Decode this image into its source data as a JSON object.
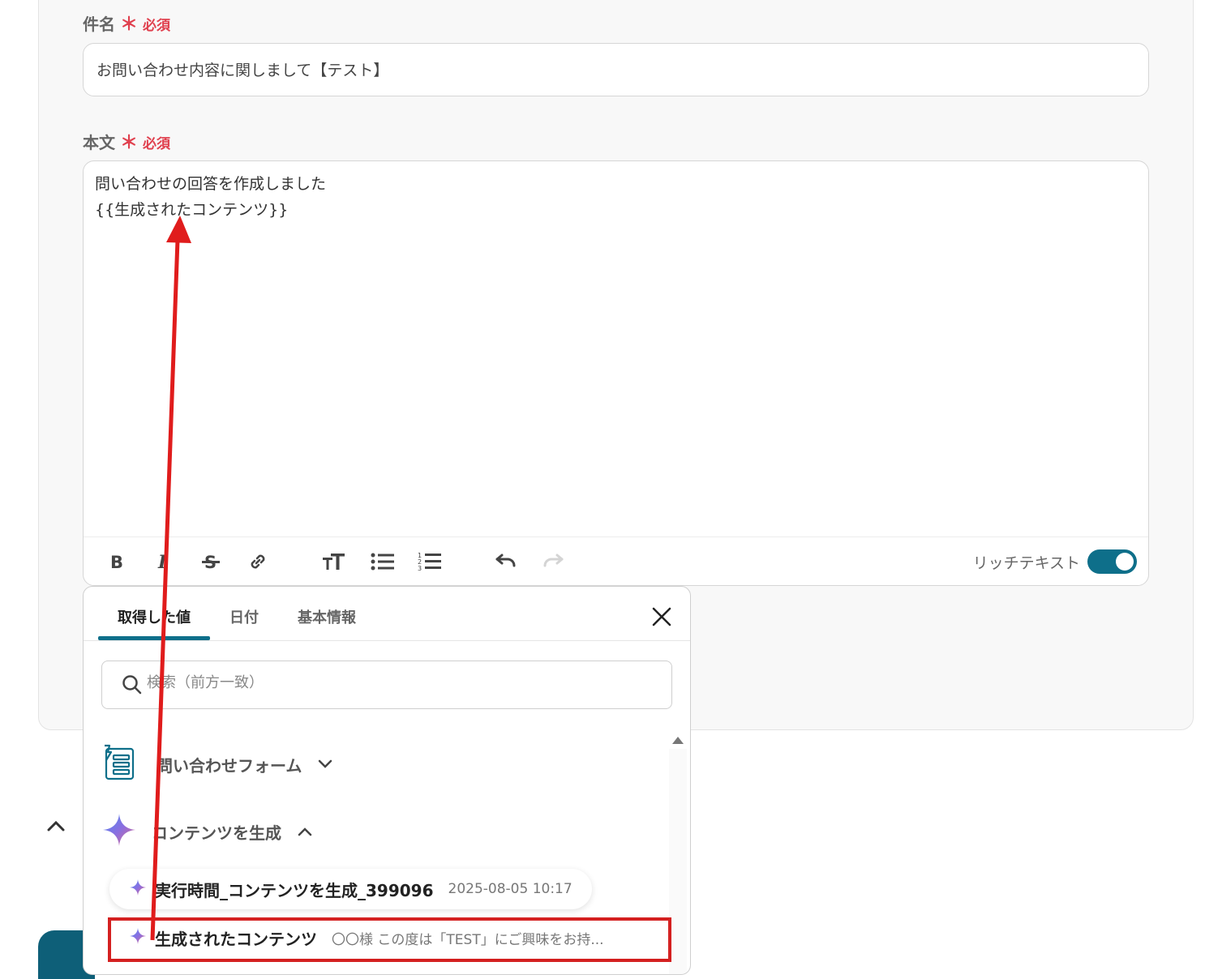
{
  "form": {
    "subject_label": "件名",
    "required_mark": "＊",
    "required_text": "必須",
    "subject_value": "お問い合わせ内容に関しまして【テスト】",
    "body_label": "本文",
    "body_line1": "問い合わせの回答を作成しました",
    "body_line2": "{{生成されたコンテンツ}}",
    "rich_text_label": "リッチテキスト",
    "rich_text_enabled": true
  },
  "toolbar": {
    "icons": [
      "bold-icon",
      "italic-icon",
      "strikethrough-icon",
      "link-icon",
      "text-size-icon",
      "bullet-list-icon",
      "numbered-list-icon",
      "undo-icon",
      "redo-icon"
    ]
  },
  "panel": {
    "tabs": [
      {
        "label": "取得した値",
        "active": true
      },
      {
        "label": "日付",
        "active": false
      },
      {
        "label": "基本情報",
        "active": false
      }
    ],
    "search_placeholder": "検索（前方一致）",
    "groups": [
      {
        "title": "問い合わせフォーム",
        "icon": "form-icon",
        "expanded": false
      },
      {
        "title": "コンテンツを生成",
        "icon": "sparkle-icon",
        "expanded": true
      }
    ],
    "items": [
      {
        "name": "実行時間_コンテンツを生成_399096",
        "value": "2025-08-05 10:17"
      },
      {
        "name": "生成されたコンテンツ",
        "value": "〇〇様 この度は「TEST」にご興味をお持..."
      }
    ]
  },
  "colors": {
    "accent": "#0e6f8a",
    "required": "#e0404e",
    "annotation": "#d42020"
  }
}
